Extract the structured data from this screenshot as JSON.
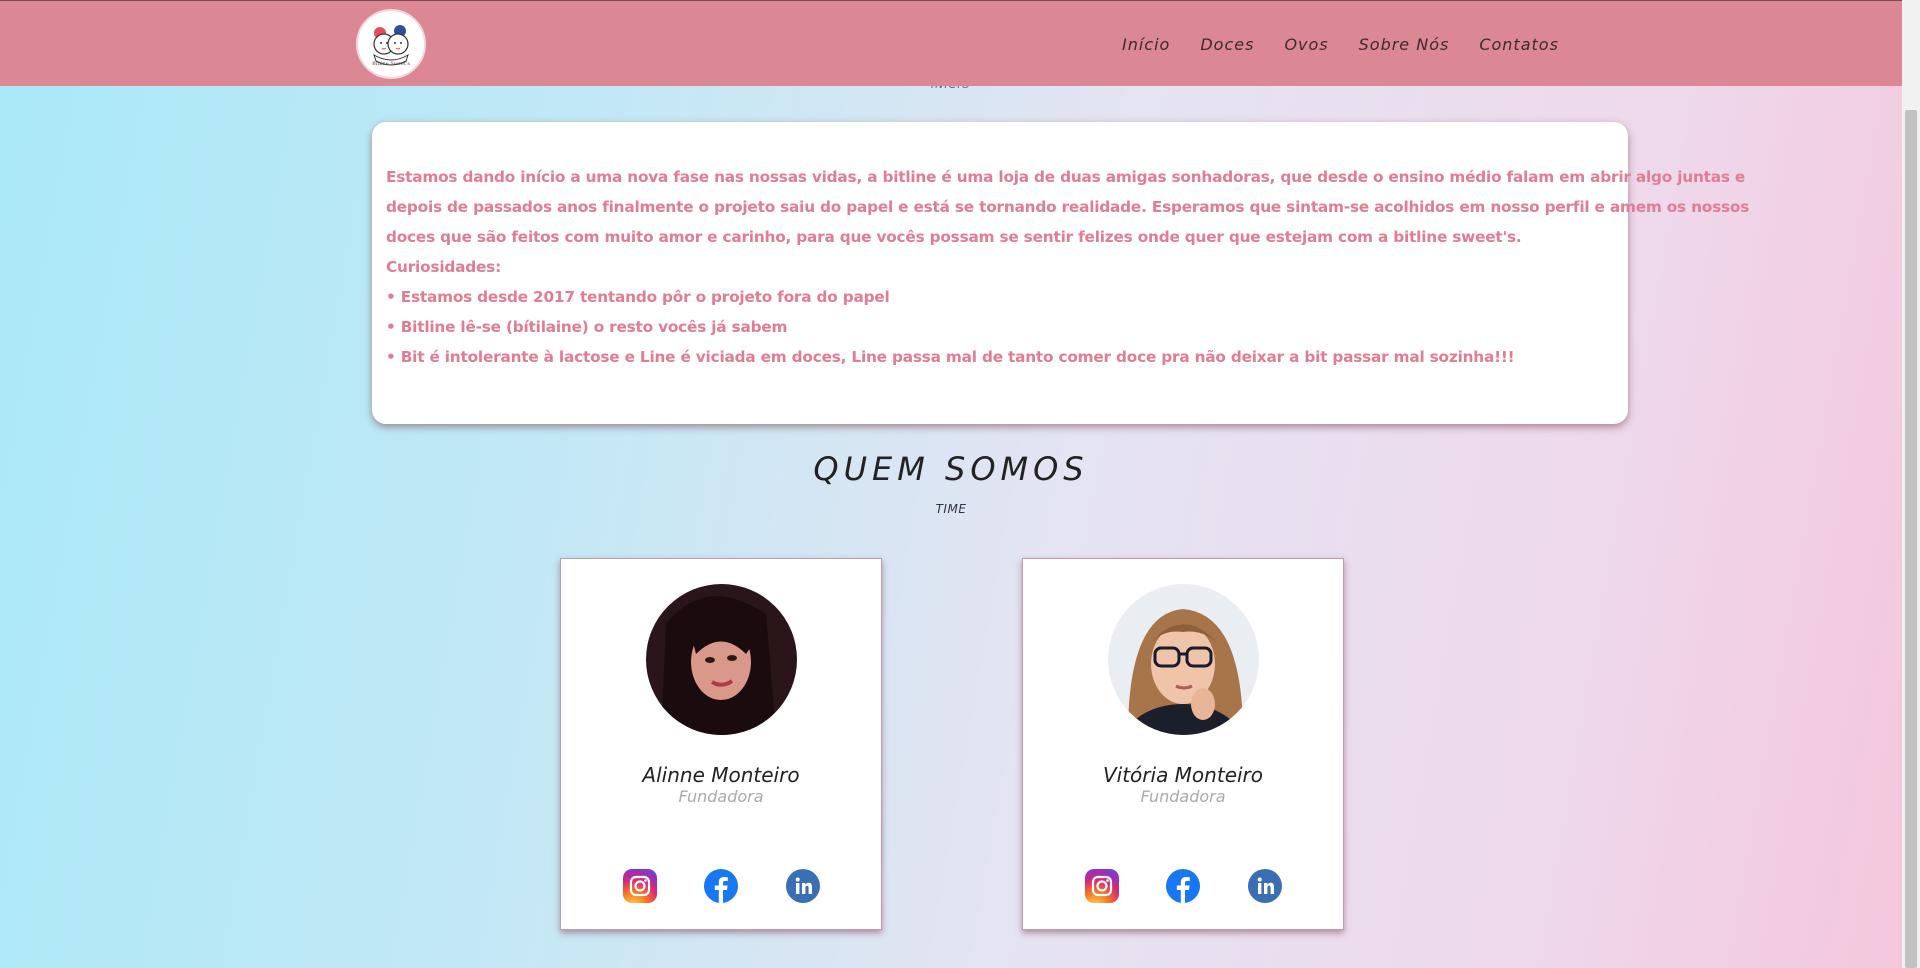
{
  "nav": {
    "logo_text": "Bitline Sweet's",
    "links": [
      "Início",
      "Doces",
      "Ovos",
      "Sobre Nós",
      "Contatos"
    ]
  },
  "hidden_subtitle": "INÍCIO",
  "about": {
    "lines": [
      "Estamos dando início a uma nova fase nas nossas vidas, a bitline é uma loja de duas amigas sonhadoras, que desde o ensino médio falam em abrir algo juntas e",
      "depois de passados anos finalmente o projeto saiu do papel e está se tornando realidade. Esperamos que sintam-se acolhidos em nosso perfil e amem os nossos",
      "doces que são feitos com muito amor e carinho, para que vocês possam se sentir felizes onde quer que estejam com a bitline sweet's.",
      "Curiosidades:",
      "• Estamos desde 2017 tentando pôr o projeto fora do papel",
      "• Bitline lê-se (bítilaine) o resto vocês já sabem",
      "• Bit é intolerante à lactose e Line é viciada em doces, Line passa mal de tanto comer doce pra não deixar a bit passar mal sozinha!!!"
    ]
  },
  "team_section": {
    "title": "QUEM SOMOS",
    "subtitle": "TIME"
  },
  "members": [
    {
      "name": "Alinne Monteiro",
      "role": "Fundadora"
    },
    {
      "name": "Vitória Monteiro",
      "role": "Fundadora"
    }
  ],
  "colors": {
    "navbar": "#db8894",
    "about_text": "#e07d91",
    "instagram": "#d62976",
    "facebook": "#1877f2",
    "linkedin": "#3a6fb5"
  },
  "icons": [
    "instagram-icon",
    "facebook-icon",
    "linkedin-icon"
  ]
}
